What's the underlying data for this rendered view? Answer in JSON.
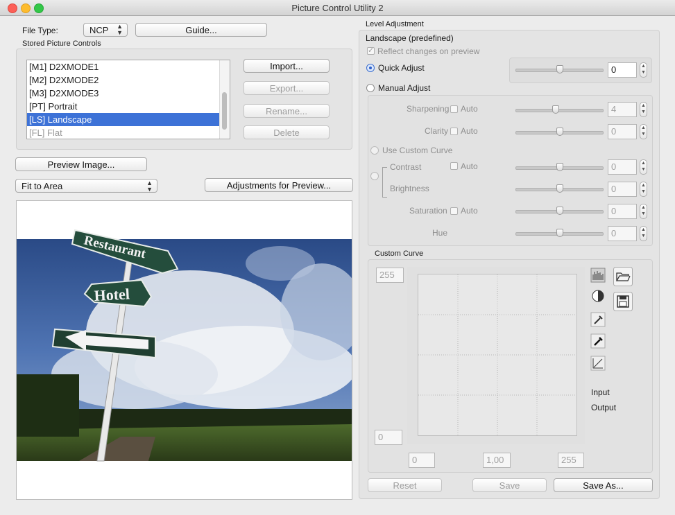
{
  "window": {
    "title": "Picture Control Utility 2"
  },
  "file_type": {
    "label": "File Type:",
    "value": "NCP",
    "guide_button": "Guide..."
  },
  "stored": {
    "label": "Stored Picture Controls",
    "items": [
      {
        "label": "[M1] D2XMODE1",
        "state": "normal"
      },
      {
        "label": "[M2] D2XMODE2",
        "state": "normal"
      },
      {
        "label": "[M3] D2XMODE3",
        "state": "normal"
      },
      {
        "label": "[PT] Portrait",
        "state": "normal"
      },
      {
        "label": "[LS] Landscape",
        "state": "selected"
      },
      {
        "label": "[FL] Flat",
        "state": "muted"
      }
    ],
    "buttons": {
      "import": "Import...",
      "export": "Export...",
      "rename": "Rename...",
      "delete": "Delete"
    }
  },
  "preview": {
    "preview_image_button": "Preview Image...",
    "fit_select": "Fit to Area",
    "adjustments_button": "Adjustments for Preview...",
    "sign_texts": {
      "restaurant": "Restaurant",
      "hotel": "Hotel"
    }
  },
  "level": {
    "group_label": "Level Adjustment",
    "title": "Landscape (predefined)",
    "reflect_label": "Reflect changes on preview",
    "quick_adjust_label": "Quick Adjust",
    "quick_value": "0",
    "quick_position": 0.5,
    "manual_adjust_label": "Manual Adjust",
    "auto_label": "Auto",
    "use_custom_curve_label": "Use Custom Curve",
    "params": {
      "sharpening": {
        "label": "Sharpening",
        "value": "4",
        "position": 0.45
      },
      "clarity": {
        "label": "Clarity",
        "value": "0",
        "position": 0.5
      },
      "contrast": {
        "label": "Contrast",
        "value": "0",
        "position": 0.5
      },
      "brightness": {
        "label": "Brightness",
        "value": "0",
        "position": 0.5
      },
      "saturation": {
        "label": "Saturation",
        "value": "0",
        "position": 0.5
      },
      "hue": {
        "label": "Hue",
        "value": "0",
        "position": 0.5
      }
    }
  },
  "curve": {
    "group_label": "Custom Curve",
    "output_max": "255",
    "output_min": "0",
    "input_min": "0",
    "gamma": "1,00",
    "input_max": "255",
    "input_label": "Input",
    "output_label": "Output"
  },
  "footer": {
    "reset": "Reset",
    "save": "Save",
    "save_as": "Save As..."
  }
}
